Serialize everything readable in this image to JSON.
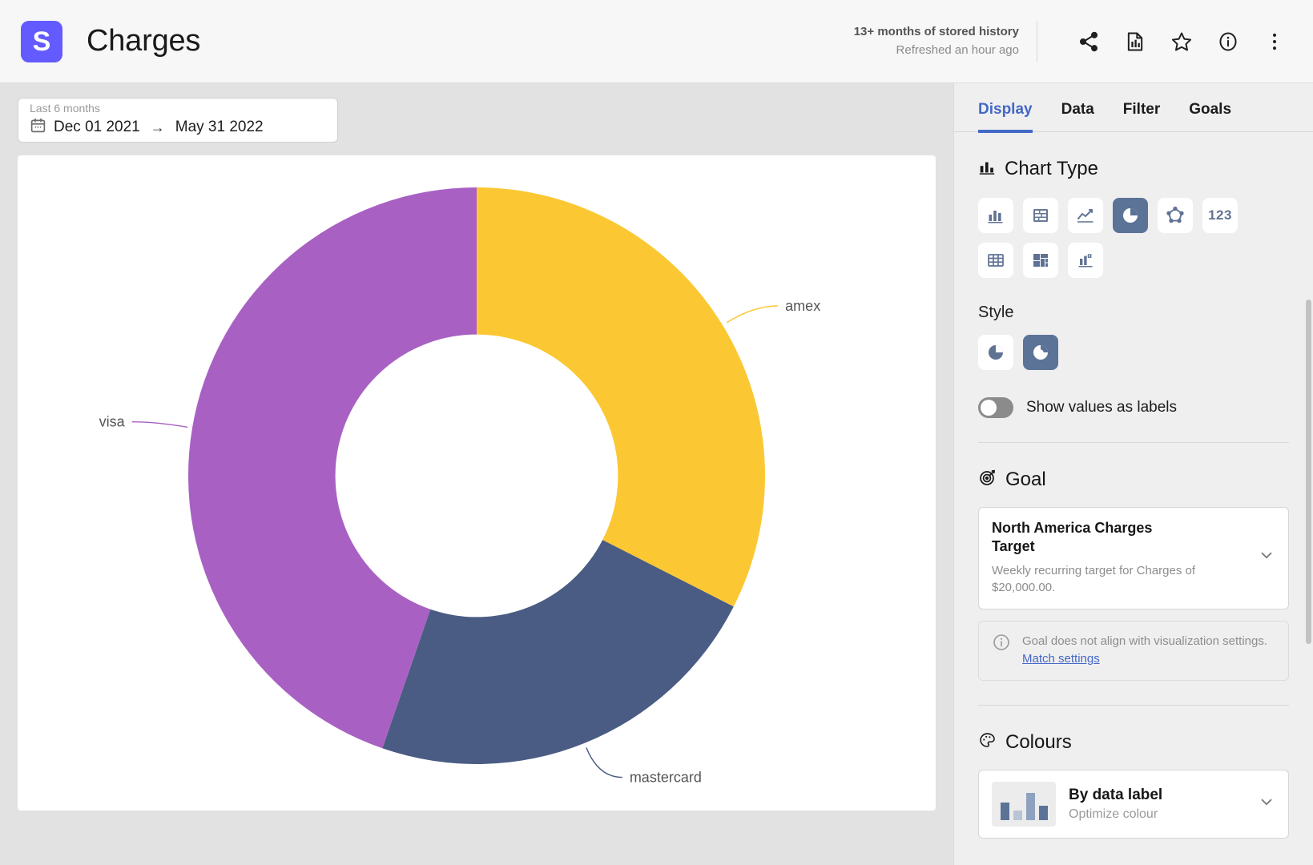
{
  "header": {
    "logo_letter": "S",
    "title": "Charges",
    "meta_primary": "13+ months of stored history",
    "meta_secondary": "Refreshed an hour ago",
    "actions": [
      {
        "name": "share-icon",
        "label": "Share"
      },
      {
        "name": "report-icon",
        "label": "Report"
      },
      {
        "name": "star-icon",
        "label": "Favourite"
      },
      {
        "name": "info-icon",
        "label": "Info"
      },
      {
        "name": "more-vertical-icon",
        "label": "More"
      }
    ]
  },
  "date_range": {
    "preset_label": "Last 6 months",
    "start": "Dec 01 2021",
    "arrow": "→",
    "end": "May 31 2022",
    "calendar_icon": "calendar-icon"
  },
  "chart_data": {
    "type": "pie",
    "title": "Charges",
    "style": "donut",
    "labels": [
      "amex",
      "mastercard",
      "visa"
    ],
    "values": [
      32.5,
      22.8,
      44.7
    ],
    "colors": [
      "#fbc833",
      "#4a5c83",
      "#a861c3"
    ],
    "start_angle_deg": 0,
    "inner_radius_ratio": 0.49,
    "legend": "labels-with-leader-lines",
    "show_values_as_labels": false
  },
  "panel": {
    "tabs": [
      {
        "label": "Display",
        "active": true
      },
      {
        "label": "Data",
        "active": false
      },
      {
        "label": "Filter",
        "active": false
      },
      {
        "label": "Goals",
        "active": false
      }
    ],
    "chart_type": {
      "heading": "Chart Type",
      "heading_icon": "bar-chart-icon",
      "options": [
        {
          "name": "column-chart-icon",
          "selected": false
        },
        {
          "name": "stacked-bar-icon",
          "selected": false
        },
        {
          "name": "line-chart-icon",
          "selected": false
        },
        {
          "name": "pie-chart-icon",
          "selected": true
        },
        {
          "name": "radar-chart-icon",
          "selected": false
        },
        {
          "name": "number-chart-icon",
          "selected": false,
          "glyph": "123"
        },
        {
          "name": "table-icon",
          "selected": false
        },
        {
          "name": "treemap-icon",
          "selected": false
        },
        {
          "name": "scatter-chart-icon",
          "selected": false
        }
      ]
    },
    "style": {
      "heading": "Style",
      "options": [
        {
          "name": "pie-style-icon",
          "selected": false
        },
        {
          "name": "donut-style-icon",
          "selected": true
        }
      ],
      "toggle_label": "Show values as labels",
      "toggle_on": false
    },
    "goal": {
      "heading": "Goal",
      "heading_icon": "target-icon",
      "title": "North America Charges Target",
      "description": "Weekly recurring target for Charges of $20,000.00.",
      "notice_text": "Goal does not align with visualization settings.",
      "notice_link": "Match settings",
      "notice_icon": "info-circle-icon"
    },
    "colours": {
      "heading": "Colours",
      "heading_icon": "palette-icon",
      "option_title": "By data label",
      "option_sub": "Optimize colour"
    }
  },
  "theme": {
    "accent": "#4368c7",
    "brand": "#635bff",
    "icon_slate": "#5c7398",
    "panel_bg": "#efefef",
    "canvas_bg": "#e2e2e2"
  }
}
